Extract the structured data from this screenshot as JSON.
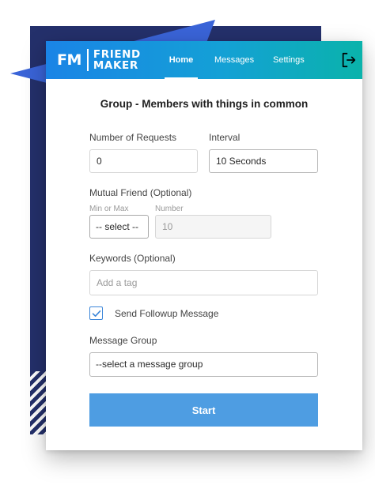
{
  "header": {
    "logo": {
      "abbr": "FM",
      "line1": "FRIEND",
      "line2": "MAKER"
    },
    "tabs": [
      {
        "label": "Home",
        "active": true
      },
      {
        "label": "Messages",
        "active": false
      },
      {
        "label": "Settings",
        "active": false
      }
    ],
    "logout_icon": "logout-icon"
  },
  "form": {
    "title": "Group - Members with things in common",
    "requests": {
      "label": "Number of Requests",
      "value": "0"
    },
    "interval": {
      "label": "Interval",
      "value": "10 Seconds"
    },
    "mutual": {
      "label": "Mutual Friend (Optional)",
      "minmax_label": "Min or Max",
      "minmax_value": "-- select --",
      "number_label": "Number",
      "number_placeholder": "10"
    },
    "keywords": {
      "label": "Keywords (Optional)",
      "placeholder": "Add a tag"
    },
    "followup": {
      "label": "Send Followup Message",
      "checked": true
    },
    "message_group": {
      "label": "Message Group",
      "value": "--select a message group"
    },
    "start_label": "Start"
  },
  "colors": {
    "header_gradient_start": "#1a84e6",
    "header_gradient_end": "#0ab3ab",
    "start_button": "#4e9de2",
    "background_navy": "#24306b",
    "triangle_accent": "#3a64d8",
    "checkbox_accent": "#3b86d9"
  }
}
